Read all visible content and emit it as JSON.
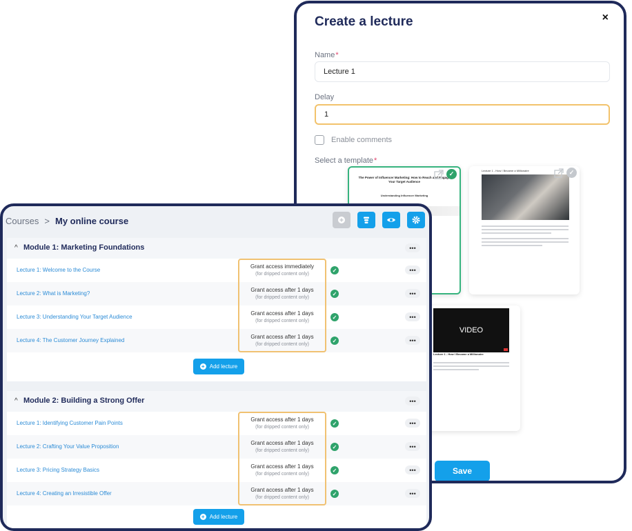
{
  "modal": {
    "title": "Create a lecture",
    "close": "×",
    "name_label": "Name",
    "required_mark": "*",
    "name_value": "Lecture 1",
    "delay_label": "Delay",
    "delay_value": "1",
    "enable_comments_label": "Enable comments",
    "template_label": "Select a template",
    "templates": [
      {
        "title": "The Power of Influencer Marketing: How to Reach and Engage Your Target Audience",
        "subtitle": "Understanding Influencer Marketing",
        "selected": true
      },
      {
        "title": "Lecture 1 - How I Became a Millionaire",
        "selected": false
      },
      {
        "video_label": "VIDEO",
        "caption": "Lecture 1 - How I Became a Millionaire",
        "selected": false
      }
    ],
    "save_label": "Save"
  },
  "course": {
    "breadcrumb_root": "Courses",
    "breadcrumb_separator": ">",
    "breadcrumb_current": "My online course",
    "toolbar_icons": [
      "add-icon",
      "stack-icon",
      "eye-icon",
      "gear-icon"
    ],
    "modules": [
      {
        "title": "Module 1: Marketing Foundations",
        "lectures": [
          {
            "title": "Lecture 1: Welcome to the Course",
            "access": "Grant access immediately",
            "note": "(for dripped content only)"
          },
          {
            "title": "Lecture 2: What is Marketing?",
            "access": "Grant access after 1 days",
            "note": "(for dripped content only)"
          },
          {
            "title": "Lecture 3: Understanding Your Target Audience",
            "access": "Grant access after 1 days",
            "note": "(for dripped content only)"
          },
          {
            "title": "Lecture 4: The Customer Journey Explained",
            "access": "Grant access after 1 days",
            "note": "(for dripped content only)"
          }
        ],
        "add_label": "Add lecture"
      },
      {
        "title": "Module 2: Building a Strong Offer",
        "lectures": [
          {
            "title": "Lecture 1: Identifying Customer Pain Points",
            "access": "Grant access after 1 days",
            "note": "(for dripped content only)"
          },
          {
            "title": "Lecture 2: Crafting Your Value Proposition",
            "access": "Grant access after 1 days",
            "note": "(for dripped content only)"
          },
          {
            "title": "Lecture 3: Pricing Strategy Basics",
            "access": "Grant access after 1 days",
            "note": "(for dripped content only)"
          },
          {
            "title": "Lecture 4: Creating an Irresistible Offer",
            "access": "Grant access after 1 days",
            "note": "(for dripped content only)"
          }
        ],
        "add_label": "Add lecture"
      }
    ]
  },
  "colors": {
    "accent": "#14a0ea",
    "frame": "#1f2a5a",
    "highlight": "#f0c171",
    "success": "#2fa36b"
  }
}
